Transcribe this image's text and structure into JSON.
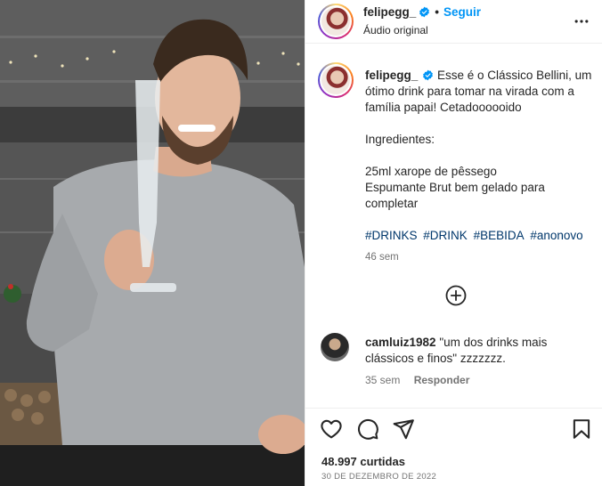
{
  "post": {
    "username": "felipegg_",
    "follow_label": "Seguir",
    "audio_label": "Áudio original",
    "separator": "•"
  },
  "caption": {
    "username": "felipegg_",
    "line1": "Esse é o Clássico Bellini, um ótimo drink para tomar na virada com a família papai! Cetadoooooido",
    "ingredients_title": "Ingredientes:",
    "ingredient1": "25ml xarope de pêssego",
    "ingredient2": "Espumante Brut bem gelado para completar",
    "hashtags": [
      "#DRINKS",
      "#DRINK",
      "#BEBIDA",
      "#anonovo"
    ],
    "time": "46 sem"
  },
  "comment": {
    "username": "camluiz1982",
    "text": "\"um dos drinks mais clássicos e finos\" zzzzzzz.",
    "time": "35 sem",
    "reply_label": "Responder"
  },
  "footer": {
    "likes": "48.997 curtidas",
    "date": "30 DE DEZEMBRO DE 2022"
  },
  "icons": {
    "like": "heart-icon",
    "comment": "comment-icon",
    "share": "share-icon",
    "save": "bookmark-icon",
    "more": "more-options-icon",
    "add_comment": "plus-circle-icon",
    "verified": "verified-badge-icon"
  },
  "colors": {
    "link": "#0095f6",
    "hashtag": "#00376b",
    "secondary_text": "#737373",
    "verified": "#0095f6"
  }
}
